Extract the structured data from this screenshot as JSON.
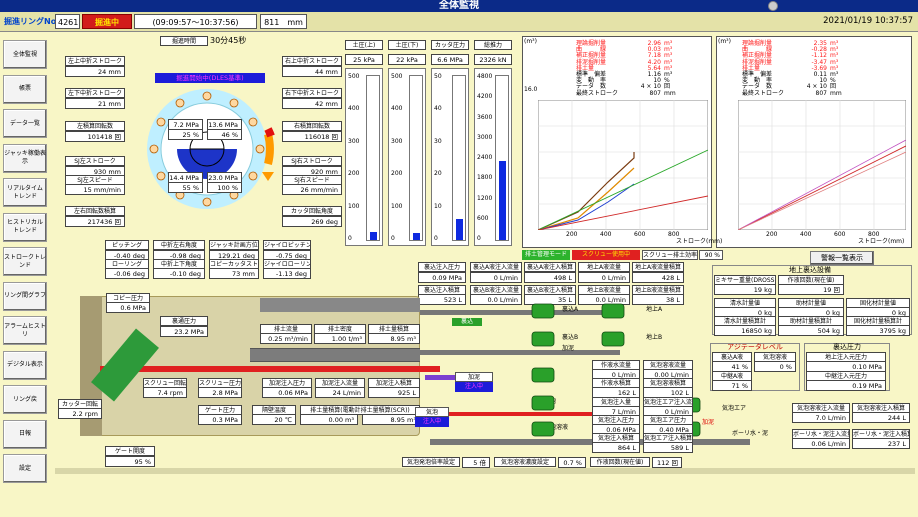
{
  "title": "全体監視",
  "header": {
    "ring_label": "掘進リングNo.",
    "ring_no": "4261",
    "status": "掘進中",
    "time_range": "(09:09:57～10:37:56)",
    "stroke": "811　mm",
    "datetime": "2021/01/19 10:37:57"
  },
  "sidebar": [
    "全体監視",
    "帳票",
    "データ一覧",
    "ジャッキ稼働表示",
    "リアルタイム\nトレンド",
    "ヒストリカル\nトレンド",
    "ストロークトレンド",
    "リング間グラフ",
    "アラームヒストリ",
    "デジタル表示",
    "リング戻",
    "日報",
    "設定"
  ],
  "left": {
    "elapsed_label": "掘進時間",
    "elapsed": "30分45秒",
    "lt_label": "左上中折ストローク",
    "lt_val": "24 mm",
    "lb_label": "左下中折ストローク",
    "lb_val": "21 mm",
    "lc_label": "左積算回転数",
    "lc_val": "101418 回",
    "lsj_label": "SJ左ストローク",
    "lsj_val": "930 mm",
    "lsp_label": "SJ左スピード",
    "lsp_val": "15 mm/min",
    "lct_label": "左右回転数積算",
    "lct_val": "217436 回",
    "rt_label": "右上中折ストローク",
    "rt_val": "44 mm",
    "rb_label": "右下中折ストローク",
    "rb_val": "42 mm",
    "rc_label": "右積算回転数",
    "rc_val": "116018 回",
    "rsj_label": "SJ右ストローク",
    "rsj_val": "920 mm",
    "rsp_label": "SJ右スピード",
    "rsp_val": "26 mm/min",
    "rot_label": "カッタ回転角度",
    "rot_val": "269 deg",
    "banner": "掘進開始中(DLES基準)",
    "q1a": "7.2 MPa",
    "q1b": "25 %",
    "q2a": "13.6 MPa",
    "q2b": "46 %",
    "q3a": "14.4 MPa",
    "q3b": "55 %",
    "q4a": "23.0 MPa",
    "q4b": "100 %"
  },
  "attitude": {
    "pitch_label": "ピッチング",
    "pitch": "-0.40 deg",
    "roll_label": "ローリング",
    "roll": "-0.06 deg",
    "mlr_label": "中折左右角度",
    "mlr": "-0.98 deg",
    "mud_label": "中折上下角度",
    "mud": "-0.10 deg",
    "jb_label": "ジャッキ計画方位角",
    "jb": "129.21 deg",
    "cop_label": "コピーカッタストローク",
    "cop": "73 mm",
    "jp_label": "ジャイロピッチング",
    "jp": "-0.75 deg",
    "jr_label": "ジャイロローリング",
    "jr": "-1.13 deg"
  },
  "gauges": [
    {
      "label": "土圧(上)",
      "value": "25 kPa",
      "ticks": [
        "500",
        "400",
        "300",
        "200",
        "100",
        "0"
      ],
      "level": 0.05
    },
    {
      "label": "土圧(下)",
      "value": "22 kPa",
      "ticks": [
        "500",
        "400",
        "300",
        "200",
        "100",
        "0"
      ],
      "level": 0.044
    },
    {
      "label": "カッタ圧力",
      "value": "6.6 MPa",
      "ticks": [
        "50",
        "40",
        "30",
        "20",
        "10",
        "0"
      ],
      "level": 0.13
    },
    {
      "label": "総推力",
      "value": "2326 kN",
      "ticks": [
        "4800",
        "4200",
        "3600",
        "3000",
        "2400",
        "1800",
        "1200",
        "600",
        "0"
      ],
      "level": 0.48
    }
  ],
  "graph1": {
    "unit": "(m³)",
    "ymax": "16.0",
    "lines": [
      {
        "label": "理論掘削量",
        "val": "2.96",
        "u": "m³"
      },
      {
        "label": "曲　　　線",
        "val": "0.03",
        "u": "m³"
      },
      {
        "label": "補正掘削量",
        "val": "7.18",
        "u": "m³"
      },
      {
        "label": "排泥掘削量",
        "val": "4.20",
        "u": "m³"
      },
      {
        "label": "排土量",
        "val": "5.64",
        "u": "m³"
      },
      {
        "label": "標準　偏差",
        "val": "1.16",
        "u": "m³"
      },
      {
        "label": "変　動　率",
        "val": "10",
        "u": "%"
      },
      {
        "label": "データ　数",
        "val": "4 × 10",
        "u": "回"
      },
      {
        "label": "最終ストローク",
        "val": "807",
        "u": "mm"
      }
    ],
    "xticks": [
      "200",
      "400",
      "600",
      "800"
    ],
    "xlabel": "ストローク(mm)"
  },
  "graph2": {
    "unit": "(m³)",
    "lines": [
      {
        "label": "理論掘削量",
        "val": "2.35",
        "u": "m³"
      },
      {
        "label": "曲　　　線",
        "val": "-0.28",
        "u": "m³"
      },
      {
        "label": "補正掘削量",
        "val": "-1.12",
        "u": "m³"
      },
      {
        "label": "排泥掘削量",
        "val": "-3.47",
        "u": "m³"
      },
      {
        "label": "排土量",
        "val": "-3.69",
        "u": "m³"
      },
      {
        "label": "標準　偏差",
        "val": "0.11",
        "u": "m³"
      },
      {
        "label": "変　動　率",
        "val": "10",
        "u": "%"
      },
      {
        "label": "データ　数",
        "val": "4 × 10",
        "u": "回"
      },
      {
        "label": "最終ストローク",
        "val": "807",
        "u": "mm"
      }
    ],
    "xticks": [
      "200",
      "400",
      "600",
      "800"
    ],
    "xlabel": "ストローク(mm)"
  },
  "statusbar": {
    "a": "排土管理モード",
    "b": "スクリュー使用中",
    "c": "スクリュー排土効率",
    "d": "90 %",
    "alarm_btn": "警報一覧表示"
  },
  "injection": {
    "p_label": "裏込注入圧力",
    "p": "0.09 MPa",
    "a_flow_label": "裏込A液注入流量",
    "a_flow": "0 L/min",
    "a_tot_label": "裏込A液注入積算",
    "a_tot": "498 L",
    "ua_flow_label": "地上A液流量",
    "ua_flow": "0 L/min",
    "ua_tot_label": "地上A液流量積算",
    "ua_tot": "428 L",
    "v_label": "裏込注入積算",
    "v": "523 L",
    "b_flow_label": "裏込B液注入流量",
    "b_flow": "0.0 L/min",
    "b_tot_label": "裏込B液注入積算",
    "b_tot": "35 L",
    "ub_flow_label": "地上B液流量",
    "ub_flow": "0.0 L/min",
    "ub_tot_label": "地上B液流量積算",
    "ub_tot": "38 L"
  },
  "machine": {
    "copy_label": "コピー圧力",
    "copy": "0.6 MPa",
    "wp_label": "裏通圧力",
    "wp": "23.2 MPa",
    "flow_label": "排土流量",
    "flow": "0.25 m³/min",
    "dens_label": "排土密度",
    "dens": "1.00 t/m³",
    "vol_label": "排土量積算",
    "vol": "8.95 m³",
    "sc_label": "スクリュー回転",
    "sc": "7.4 rpm",
    "sp_label": "スクリュー圧力",
    "sp": "2.8 MPa",
    "add_p_label": "加泥注入圧力",
    "add_p": "0.06 MPa",
    "add_f_label": "加泥注入流量",
    "add_f": "24 L/min",
    "add_t_label": "加泥注入積算",
    "add_t": "925 L",
    "gate_label": "ゲート圧力",
    "gate": "0.3 MPa",
    "temp_label": "隔壁温度",
    "temp": "20 ℃",
    "eq_label": "排土量積算(電動計排土量積算(SCR))",
    "eq": "0.00 m³",
    "eq2": "8.95 m³",
    "cut_label": "カッター回転",
    "cut": "2.2 rpm",
    "gateo_label": "ゲート開度",
    "gateo": "95 %",
    "c_label1": "加泥",
    "c_label2": "注入中",
    "f_label1": "気泡",
    "f_label2": "注入中",
    "tag1": "裏込",
    "tag2": "加泥",
    "tag3": "地上A",
    "tag4": "地上B",
    "tag5": "裏込A",
    "tag6": "裏込B",
    "tag7": "気泡",
    "tag8": "気泡溶液",
    "tag9": "気泡エア",
    "tag10": "加泥",
    "tag11": "ボーリ水・泥"
  },
  "surface": {
    "title": "地上裏込設備",
    "in_label": "ミキサー重量(DROSS)",
    "in_val": "19 kg",
    "cnt_label": "作液回数(現在値)",
    "cnt": "19 回",
    "w_label": "清水計量値",
    "w": "0 kg",
    "m_label": "助材計量値",
    "m": "0 kg",
    "s_label": "固化材計量値",
    "s": "0 kg",
    "wt_label": "清水計量積算計",
    "wt": "16850 kg",
    "mt_label": "助材計量積算計",
    "mt": "504 kg",
    "st_label": "固化材計量積算計",
    "st": "3795 kg"
  },
  "agitator": {
    "title": "アジテータレベル",
    "a_label": "裏込A液",
    "a": "41 %",
    "f_label": "気泡溶液",
    "f": "0 %",
    "m_label": "中継A液",
    "m": "71 %"
  },
  "backfill": {
    "title": "裏込圧力",
    "p1_label": "地上注入元圧力",
    "p1": "0.10 MPa",
    "p2_label": "中継注入元圧力",
    "p2": "0.19 MPa"
  },
  "foam": {
    "fr_label": "作液水流量",
    "fr": "0 L/min",
    "ft_label": "作液水積算",
    "ft": "162 L",
    "sr_label": "気泡溶液流量",
    "sr": "0.00 L/min",
    "st_label": "気泡溶液積算",
    "st": "102 L",
    "ai_label": "気泡注入量",
    "ai": "7 L/min",
    "ap_label": "気泡注入圧力",
    "ap": "0.06 MPa",
    "at_label": "気泡注入積算",
    "at": "864 L",
    "ei_label": "気泡注エア注入流量",
    "ei": "0 L/min",
    "ep_label": "気泡エア圧力",
    "ep": "0.40 MPa",
    "et_label": "気泡エア注入積算",
    "et": "589 L",
    "rate_label": "気泡発泡倍率設定",
    "rate": "5 倍",
    "conc_label": "気泡溶液濃度設定",
    "conc": "0.7 %",
    "pump_label": "作液回数(現在値)",
    "pump": "112 回"
  },
  "right_bottom": {
    "r1_label": "気泡溶液注入流量",
    "r1": "7.0 L/min",
    "r2_label": "気泡溶液注入積算",
    "r2": "244 L",
    "r3_label": "ボーリ水・泥注入流量",
    "r3": "0.06 L/min",
    "r4_label": "ボーリ水・泥注入積算",
    "r4": "237 L"
  }
}
